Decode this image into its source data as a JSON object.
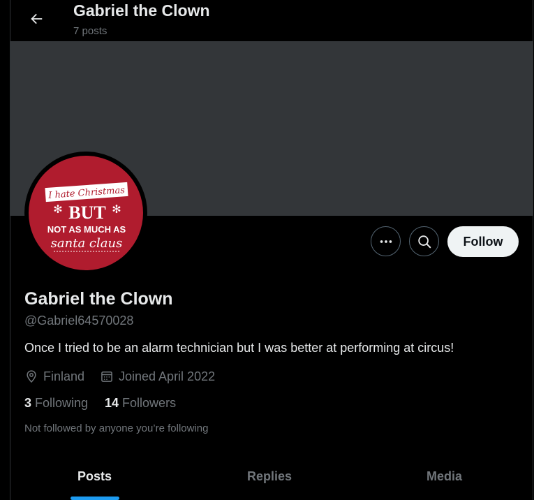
{
  "header": {
    "title": "Gabriel the Clown",
    "post_count": "7 posts"
  },
  "profile": {
    "display_name": "Gabriel the Clown",
    "handle": "@Gabriel64570028",
    "bio": "Once I tried to be an alarm technician but I was better at performing at circus!",
    "location": "Finland",
    "joined": "Joined April 2022",
    "following_count": "3",
    "following_label": "Following",
    "followers_count": "14",
    "followers_label": "Followers",
    "not_followed_note": "Not followed by anyone you’re following",
    "avatar": {
      "line1": "I hate Christmas",
      "line2": "BUT",
      "line3": "NOT AS MUCH AS",
      "line4": "santa claus",
      "background": "#b01c2e"
    }
  },
  "actions": {
    "follow_label": "Follow",
    "more_icon": "more-horizontal-icon",
    "search_icon": "search-icon"
  },
  "tabs": [
    {
      "label": "Posts",
      "active": true
    },
    {
      "label": "Replies",
      "active": false
    },
    {
      "label": "Media",
      "active": false
    }
  ],
  "colors": {
    "accent": "#1d9bf0",
    "banner": "#333639",
    "secondary_text": "#71767b"
  }
}
